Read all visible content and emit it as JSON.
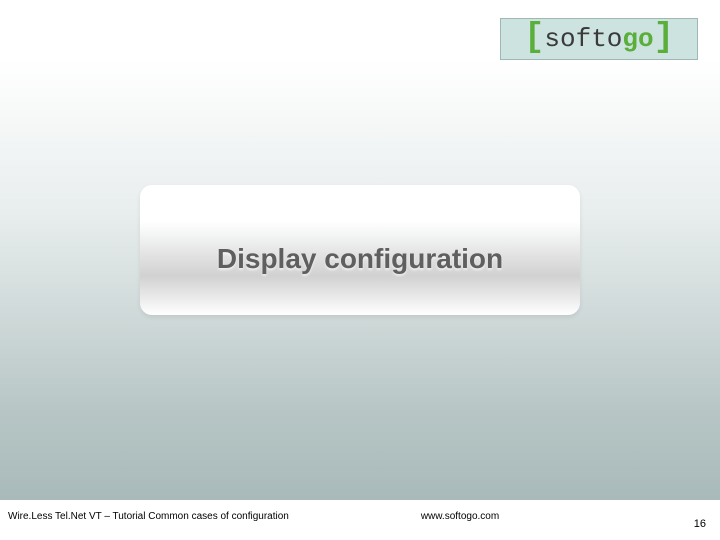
{
  "logo": {
    "brand_prefix": "sof",
    "brand_mid": "to",
    "brand_suffix": "go"
  },
  "title": "Display configuration",
  "footer": {
    "left": "Wire.Less Tel.Net VT – Tutorial Common cases of configuration",
    "center": "www.softogo.com",
    "page": "16"
  }
}
